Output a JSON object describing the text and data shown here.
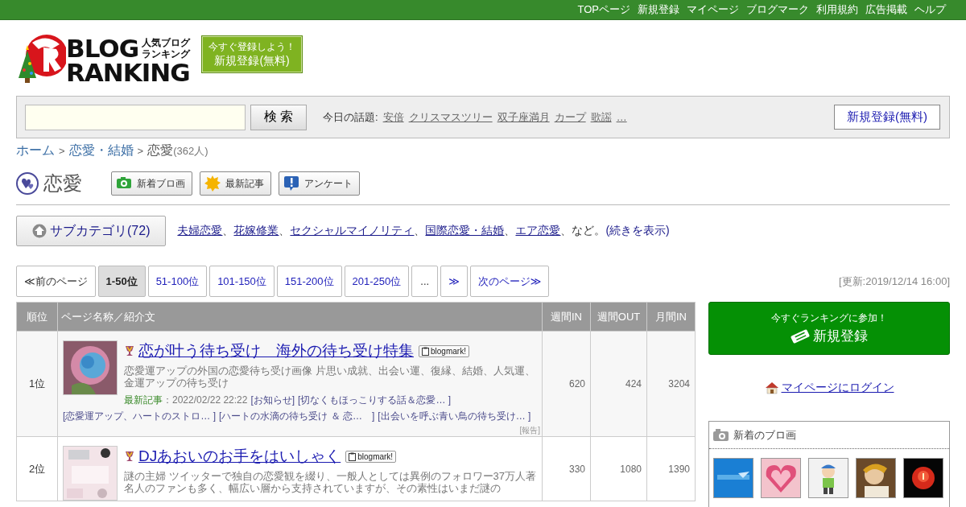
{
  "top_nav": [
    "TOPページ",
    "新規登録",
    "マイページ",
    "ブログマーク",
    "利用規約",
    "広告掲載",
    "ヘルプ"
  ],
  "logo": {
    "line1": "BLOG",
    "line2": "RANKING",
    "tag1": "人気ブログ",
    "tag2": "ランキング"
  },
  "signup_badge": {
    "note": "今すぐ登録しよう！",
    "label": "新規登録(無料)"
  },
  "search": {
    "button": "検 索",
    "topics_label": "今日の話題:",
    "topics": [
      "安倍",
      "クリスマスツリー",
      "双子座満月",
      "カープ",
      "歌謡",
      "…"
    ],
    "register": "新規登録(無料)"
  },
  "breadcrumb": {
    "separator": ">",
    "items": [
      "ホーム",
      "恋愛・結婚",
      "恋愛"
    ],
    "count": "(362人)"
  },
  "category": {
    "title": "恋愛",
    "tools": [
      {
        "kind": "camera",
        "label": "新着ブロ画"
      },
      {
        "kind": "new",
        "label": "最新記事"
      },
      {
        "kind": "survey",
        "label": "アンケート"
      }
    ]
  },
  "subcategories": {
    "separator": "、",
    "button": "サブカテゴリ(72)",
    "links": [
      "夫婦恋愛",
      "花嫁修業",
      "セクシャルマイノリティ",
      "国際恋愛・結婚",
      "エア恋愛"
    ],
    "suffix": "、など。",
    "more": "(続きを表示)"
  },
  "pagination": {
    "items": [
      {
        "kind": "nav",
        "label": "≪前のページ",
        "selected": false
      },
      {
        "kind": "page",
        "label": "1-50位",
        "selected": true
      },
      {
        "kind": "page",
        "label": "51-100位",
        "selected": false
      },
      {
        "kind": "page",
        "label": "101-150位",
        "selected": false
      },
      {
        "kind": "page",
        "label": "151-200位",
        "selected": false
      },
      {
        "kind": "page",
        "label": "201-250位",
        "selected": false
      },
      {
        "kind": "gap",
        "label": "...",
        "selected": false
      },
      {
        "kind": "page",
        "label": "≫",
        "selected": false
      },
      {
        "kind": "page",
        "label": "次のページ≫",
        "selected": false
      }
    ],
    "updated": "[更新:2019/12/14 16:00]"
  },
  "table": {
    "columns": [
      "順位",
      "ページ名称／紹介文",
      "週間IN",
      "週間OUT",
      "月間IN"
    ],
    "rows": [
      {
        "rank": "1位",
        "title": "恋が叶う待ち受け　海外の待ち受け特集",
        "badge": "blogmark!",
        "description": "恋愛運アップの外国の恋愛待ち受け画像 片思い成就、出会い運、復縁、結婚、人気運、金運アップの待ち受け",
        "latest_label": "最新記事",
        "latest_date": "：2022/02/22 22:22",
        "articles": [
          "[お知らせ]",
          "[切なくもほっこりする話＆恋愛… ]",
          "[恋愛運アップ、ハートのストロ… ]",
          "[ハートの水滴の待ち受け ＆ 恋…　]",
          "[出会いを呼ぶ青い鳥の待ち受け… ]"
        ],
        "report": "[報告]",
        "week_in": "620",
        "week_out": "424",
        "month_in": "3204"
      },
      {
        "rank": "2位",
        "title": "DJあおいのお手をはいしゃく",
        "badge": "blogmark!",
        "description": "謎の主婦 ツイッターで独自の恋愛観を綴り、一般人としては異例のフォロワー37万人著名人のファンも多く、幅広い層から支持されていますが、その素性はいまだ謎の",
        "week_in": "330",
        "week_out": "1080",
        "month_in": "1390"
      }
    ]
  },
  "sidebar": {
    "join": {
      "note": "今すぐランキングに参加！",
      "label": "新規登録"
    },
    "login": "マイページにログイン",
    "new_pics": {
      "title": "新着のブロ画"
    }
  }
}
